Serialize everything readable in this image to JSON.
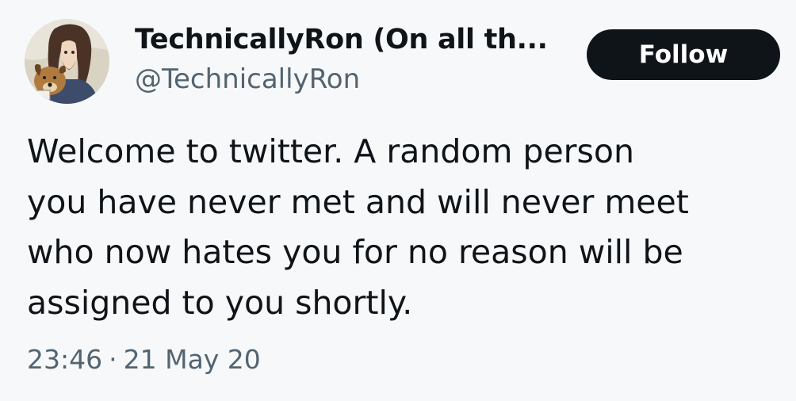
{
  "author": {
    "display_name": "TechnicallyRon (On all th...",
    "handle": "@TechnicallyRon"
  },
  "follow_button": {
    "label": "Follow"
  },
  "tweet": {
    "text_lines": [
      "Welcome to twitter. A random person",
      "you have never met and will never meet",
      "who now hates you for no reason will be",
      "assigned to you shortly."
    ],
    "time": "23:46",
    "separator": "·",
    "date": "21 May 20"
  },
  "colors": {
    "background": "#f7f8f9",
    "primary_text": "#0f1419",
    "secondary_text": "#536471",
    "button_bg": "#0f1419",
    "button_text": "#ffffff"
  }
}
